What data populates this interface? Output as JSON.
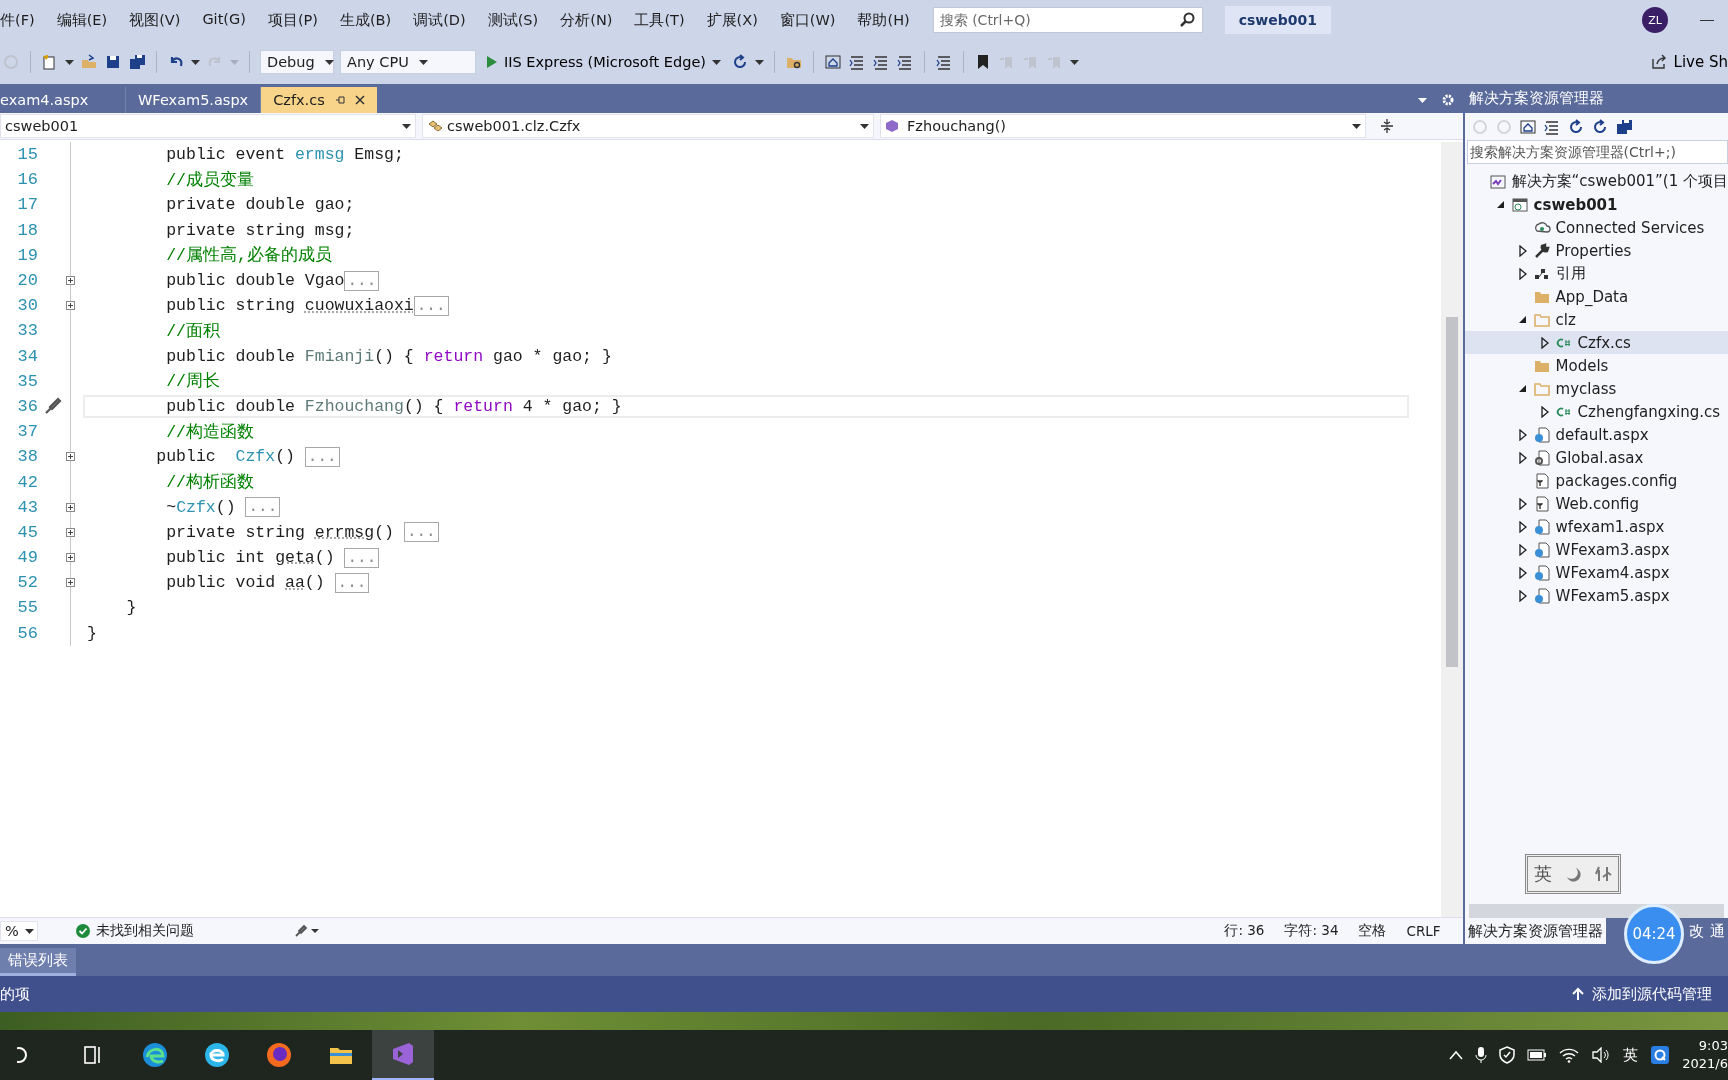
{
  "menu": [
    {
      "label": "件(F)"
    },
    {
      "label": "编辑(E)"
    },
    {
      "label": "视图(V)"
    },
    {
      "label": "Git(G)"
    },
    {
      "label": "项目(P)"
    },
    {
      "label": "生成(B)"
    },
    {
      "label": "调试(D)"
    },
    {
      "label": "测试(S)"
    },
    {
      "label": "分析(N)"
    },
    {
      "label": "工具(T)"
    },
    {
      "label": "扩展(X)"
    },
    {
      "label": "窗口(W)"
    },
    {
      "label": "帮助(H)"
    }
  ],
  "search": {
    "placeholder": "搜索 (Ctrl+Q)"
  },
  "solution_name": "csweb001",
  "avatar": "ZL",
  "toolbar": {
    "left_buttons": [
      {
        "kind": "back",
        "disabled": true
      },
      {
        "kind": "new-item",
        "disabled": false
      },
      {
        "kind": "open",
        "disabled": false
      },
      {
        "kind": "save",
        "disabled": false
      },
      {
        "kind": "save-all",
        "disabled": false
      },
      {
        "kind": "undo",
        "disabled": false
      },
      {
        "kind": "redo",
        "disabled": true
      }
    ],
    "configuration": "Debug",
    "platform": "Any CPU",
    "run_target": "IIS Express (Microsoft Edge)",
    "right_buttons": [
      {
        "kind": "refresh",
        "disabled": false
      },
      {
        "kind": "find-folder",
        "disabled": false
      },
      {
        "kind": "home",
        "disabled": false
      },
      {
        "kind": "indent-left",
        "disabled": false
      },
      {
        "kind": "indent-block",
        "disabled": false
      },
      {
        "kind": "outdent",
        "disabled": false
      },
      {
        "kind": "comment",
        "disabled": false
      },
      {
        "kind": "bookmark",
        "disabled": false
      },
      {
        "kind": "bookmark-prev",
        "disabled": true
      },
      {
        "kind": "bookmark-next",
        "disabled": true
      },
      {
        "kind": "bookmark-clear",
        "disabled": true
      }
    ],
    "live_share": "Live Sh"
  },
  "tabs": [
    {
      "label": "exam4.aspx",
      "selected": false
    },
    {
      "label": "WFexam5.aspx",
      "selected": false
    },
    {
      "label": "Czfx.cs",
      "selected": true
    }
  ],
  "nav_bar": {
    "project": "csweb001",
    "class": "csweb001.clz.Czfx",
    "member": "Fzhouchang()"
  },
  "code_lines": [
    {
      "number": "15",
      "folded": false,
      "current": false,
      "code": [
        {
          "text": "        public event ",
          "kind": "plain"
        },
        {
          "text": "ermsg",
          "kind": "type"
        },
        {
          "text": " Emsg;",
          "kind": "plain"
        }
      ]
    },
    {
      "number": "16",
      "folded": false,
      "current": false,
      "code": [
        {
          "text": "        //成员变量",
          "kind": "comment"
        }
      ]
    },
    {
      "number": "17",
      "folded": false,
      "current": false,
      "code": [
        {
          "text": "        private double gao;",
          "kind": "plain"
        }
      ]
    },
    {
      "number": "18",
      "folded": false,
      "current": false,
      "code": [
        {
          "text": "        private string msg;",
          "kind": "plain"
        }
      ]
    },
    {
      "number": "19",
      "folded": false,
      "current": false,
      "code": [
        {
          "text": "        //属性高,必备的成员",
          "kind": "comment"
        }
      ]
    },
    {
      "number": "20",
      "folded": true,
      "current": false,
      "preview": "...",
      "code": [
        {
          "text": "        public double Vgao",
          "kind": "plain"
        }
      ]
    },
    {
      "number": "30",
      "folded": true,
      "current": false,
      "preview": "...",
      "code": [
        {
          "text": "        public string ",
          "kind": "plain"
        },
        {
          "text": "cuowuxiaoxi",
          "kind": "hinted"
        }
      ]
    },
    {
      "number": "33",
      "folded": false,
      "current": false,
      "code": [
        {
          "text": "        //面积",
          "kind": "comment"
        }
      ]
    },
    {
      "number": "34",
      "folded": false,
      "current": false,
      "code": [
        {
          "text": "        public double ",
          "kind": "plain"
        },
        {
          "text": "Fmianji",
          "kind": "method"
        },
        {
          "text": "() { ",
          "kind": "plain"
        },
        {
          "text": "return",
          "kind": "keyword"
        },
        {
          "text": " gao * gao; }",
          "kind": "plain"
        }
      ]
    },
    {
      "number": "35",
      "folded": false,
      "current": false,
      "code": [
        {
          "text": "        //周长",
          "kind": "comment"
        }
      ]
    },
    {
      "number": "36",
      "folded": false,
      "current": true,
      "code": [
        {
          "text": "        public double ",
          "kind": "plain"
        },
        {
          "text": "Fzhouchang",
          "kind": "method"
        },
        {
          "text": "() { ",
          "kind": "plain"
        },
        {
          "text": "return",
          "kind": "keyword"
        },
        {
          "text": " 4 * gao; }",
          "kind": "plain"
        }
      ]
    },
    {
      "number": "37",
      "folded": false,
      "current": false,
      "code": [
        {
          "text": "        //构造函数",
          "kind": "comment"
        }
      ]
    },
    {
      "number": "38",
      "folded": true,
      "current": false,
      "preview": "...",
      "code": [
        {
          "text": "       public  ",
          "kind": "plain"
        },
        {
          "text": "Czfx",
          "kind": "type"
        },
        {
          "text": "() ",
          "kind": "plain"
        }
      ]
    },
    {
      "number": "42",
      "folded": false,
      "current": false,
      "code": [
        {
          "text": "        //构析函数",
          "kind": "comment"
        }
      ]
    },
    {
      "number": "43",
      "folded": true,
      "current": false,
      "preview": "...",
      "code": [
        {
          "text": "        ~",
          "kind": "plain"
        },
        {
          "text": "Czfx",
          "kind": "type"
        },
        {
          "text": "() ",
          "kind": "plain"
        }
      ]
    },
    {
      "number": "45",
      "folded": true,
      "current": false,
      "preview": "...",
      "code": [
        {
          "text": "        private string ",
          "kind": "plain"
        },
        {
          "text": "errmsg",
          "kind": "hinted"
        },
        {
          "text": "() ",
          "kind": "plain"
        }
      ]
    },
    {
      "number": "49",
      "folded": true,
      "current": false,
      "preview": "...",
      "code": [
        {
          "text": "        public int ",
          "kind": "plain"
        },
        {
          "text": "geta",
          "kind": "hinted"
        },
        {
          "text": "() ",
          "kind": "plain"
        }
      ]
    },
    {
      "number": "52",
      "folded": true,
      "current": false,
      "preview": "...",
      "code": [
        {
          "text": "        public void ",
          "kind": "plain"
        },
        {
          "text": "aa",
          "kind": "hinted"
        },
        {
          "text": "() ",
          "kind": "plain"
        }
      ]
    },
    {
      "number": "55",
      "folded": false,
      "current": false,
      "code": [
        {
          "text": "    }",
          "kind": "plain"
        }
      ]
    },
    {
      "number": "56",
      "folded": false,
      "current": false,
      "code": [
        {
          "text": "}",
          "kind": "plain"
        }
      ]
    }
  ],
  "editor_status": {
    "zoom": "%",
    "issues": "未找到相关问题",
    "line": "行: 36",
    "column": "字符: 34",
    "whitespace": "空格",
    "line_ending": "CRLF"
  },
  "solution_explorer": {
    "title": "解决方案资源管理器",
    "search_placeholder": "搜索解决方案资源管理器(Ctrl+;)",
    "tree": [
      {
        "label": "解决方案“csweb001”(1 个项目",
        "kind": "solution",
        "selected": false,
        "children": [
          {
            "label": "csweb001",
            "kind": "project",
            "expanded": true,
            "selected": false,
            "children": [
              {
                "label": "Connected Services",
                "kind": "connected",
                "selected": false
              },
              {
                "label": "Properties",
                "kind": "wrench",
                "expanded": false,
                "selected": false
              },
              {
                "label": "引用",
                "kind": "references",
                "expanded": false,
                "selected": false
              },
              {
                "label": "App_Data",
                "kind": "folder",
                "selected": false
              },
              {
                "label": "clz",
                "kind": "folder-open",
                "expanded": true,
                "selected": false,
                "children": [
                  {
                    "label": "Czfx.cs",
                    "kind": "csharp",
                    "expanded": false,
                    "selected": true
                  }
                ]
              },
              {
                "label": "Models",
                "kind": "folder",
                "selected": false
              },
              {
                "label": "myclass",
                "kind": "folder-open",
                "expanded": true,
                "selected": false,
                "children": [
                  {
                    "label": "Czhengfangxing.cs",
                    "kind": "csharp",
                    "expanded": false,
                    "selected": false
                  }
                ]
              },
              {
                "label": "default.aspx",
                "kind": "web-page",
                "expanded": false,
                "selected": false
              },
              {
                "label": "Global.asax",
                "kind": "gear-page",
                "expanded": false,
                "selected": false
              },
              {
                "label": "packages.config",
                "kind": "config",
                "selected": false
              },
              {
                "label": "Web.config",
                "kind": "config",
                "expanded": false,
                "selected": false
              },
              {
                "label": "wfexam1.aspx",
                "kind": "web-page",
                "expanded": false,
                "selected": false
              },
              {
                "label": "WFexam3.aspx",
                "kind": "web-page",
                "expanded": false,
                "selected": false
              },
              {
                "label": "WFexam4.aspx",
                "kind": "web-page",
                "expanded": false,
                "selected": false
              },
              {
                "label": "WFexam5.aspx",
                "kind": "web-page",
                "expanded": false,
                "selected": false
              }
            ]
          }
        ]
      }
    ],
    "bottom_tabs": [
      {
        "label": "解决方案资源管理器",
        "selected": true
      },
      {
        "label": "改",
        "selected": false
      },
      {
        "label": "通",
        "selected": false
      }
    ]
  },
  "ime_indicator": {
    "text": "英"
  },
  "recording_timer": {
    "text": "04:24"
  },
  "tool_panel_tabs": [
    {
      "label": "错误列表",
      "selected": true
    }
  ],
  "status_bar": {
    "left": "的项",
    "right": "添加到源代码管理"
  },
  "taskbar": {
    "apps": [
      {
        "kind": "start",
        "active": false
      },
      {
        "kind": "task-view",
        "active": false
      },
      {
        "kind": "edge",
        "active": false
      },
      {
        "kind": "ie",
        "active": false
      },
      {
        "kind": "firefox",
        "active": false
      },
      {
        "kind": "explorer",
        "active": false
      },
      {
        "kind": "visual-studio",
        "active": true
      }
    ],
    "input_language": "英",
    "time": "9:03",
    "date": "2021/6"
  }
}
